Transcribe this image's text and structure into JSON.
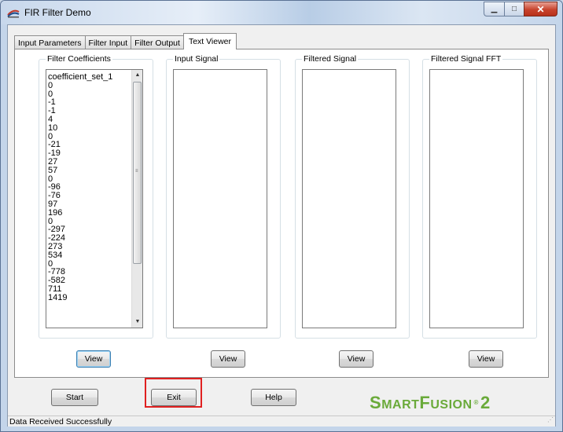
{
  "window": {
    "title": "FIR Filter Demo",
    "icon": "app-logo-icon"
  },
  "tabs": [
    {
      "label": "Input Parameters",
      "active": false
    },
    {
      "label": "Filter Input",
      "active": false
    },
    {
      "label": "Filter Output",
      "active": false
    },
    {
      "label": "Text Viewer",
      "active": true
    }
  ],
  "panels": {
    "coefficients": {
      "label": "Filter Coefficients",
      "items": [
        "coefficient_set_1",
        "0",
        "0",
        "-1",
        "-1",
        "4",
        "10",
        "0",
        "-21",
        "-19",
        "27",
        "57",
        "0",
        "-96",
        "-76",
        "97",
        "196",
        "0",
        "-297",
        "-224",
        "273",
        "534",
        "0",
        "-778",
        "-582",
        "711",
        "1419"
      ]
    },
    "input_signal": {
      "label": "Input Signal"
    },
    "filtered_signal": {
      "label": "Filtered Signal"
    },
    "filtered_fft": {
      "label": "Filtered Signal FFT"
    }
  },
  "view_buttons": [
    "View",
    "View",
    "View",
    "View"
  ],
  "bottom_buttons": {
    "start": "Start",
    "exit": "Exit",
    "help": "Help"
  },
  "logo": {
    "part1": "S",
    "part2": "M",
    "part3": "A",
    "part4": "RT",
    "part5": "F",
    "part6": "USION",
    "reg": "®",
    "num": "2"
  },
  "status": "Data Received Successfully",
  "colors": {
    "highlight": "#e02020",
    "logo": "#6aaa3a",
    "close_button": "#c7432c"
  }
}
